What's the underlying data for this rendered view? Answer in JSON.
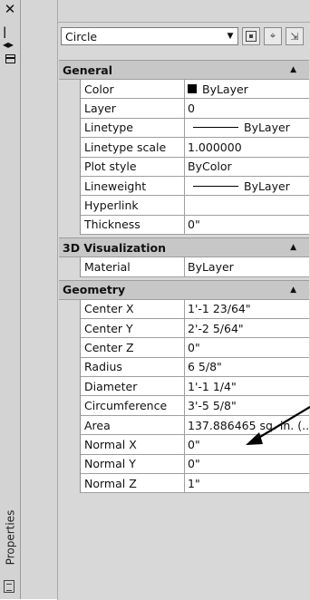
{
  "palette": {
    "title": "Properties",
    "selection": "Circle"
  },
  "categories": [
    {
      "name": "General",
      "rows": [
        {
          "name": "Color",
          "value": "ByLayer",
          "kind": "color"
        },
        {
          "name": "Layer",
          "value": "0"
        },
        {
          "name": "Linetype",
          "value": "ByLayer",
          "kind": "line"
        },
        {
          "name": "Linetype scale",
          "value": "1.000000"
        },
        {
          "name": "Plot style",
          "value": "ByColor"
        },
        {
          "name": "Lineweight",
          "value": "ByLayer",
          "kind": "line"
        },
        {
          "name": "Hyperlink",
          "value": ""
        },
        {
          "name": "Thickness",
          "value": "0\""
        }
      ]
    },
    {
      "name": "3D Visualization",
      "rows": [
        {
          "name": "Material",
          "value": "ByLayer"
        }
      ]
    },
    {
      "name": "Geometry",
      "rows": [
        {
          "name": "Center X",
          "value": "1'-1 23/64\""
        },
        {
          "name": "Center Y",
          "value": "2'-2 5/64\""
        },
        {
          "name": "Center Z",
          "value": "0\""
        },
        {
          "name": "Radius",
          "value": "6 5/8\""
        },
        {
          "name": "Diameter",
          "value": "1'-1 1/4\""
        },
        {
          "name": "Circumference",
          "value": "3'-5 5/8\""
        },
        {
          "name": "Area",
          "value": "137.886465 sq. in. (..."
        },
        {
          "name": "Normal X",
          "value": "0\""
        },
        {
          "name": "Normal Y",
          "value": "0\""
        },
        {
          "name": "Normal Z",
          "value": "1\""
        }
      ]
    }
  ]
}
